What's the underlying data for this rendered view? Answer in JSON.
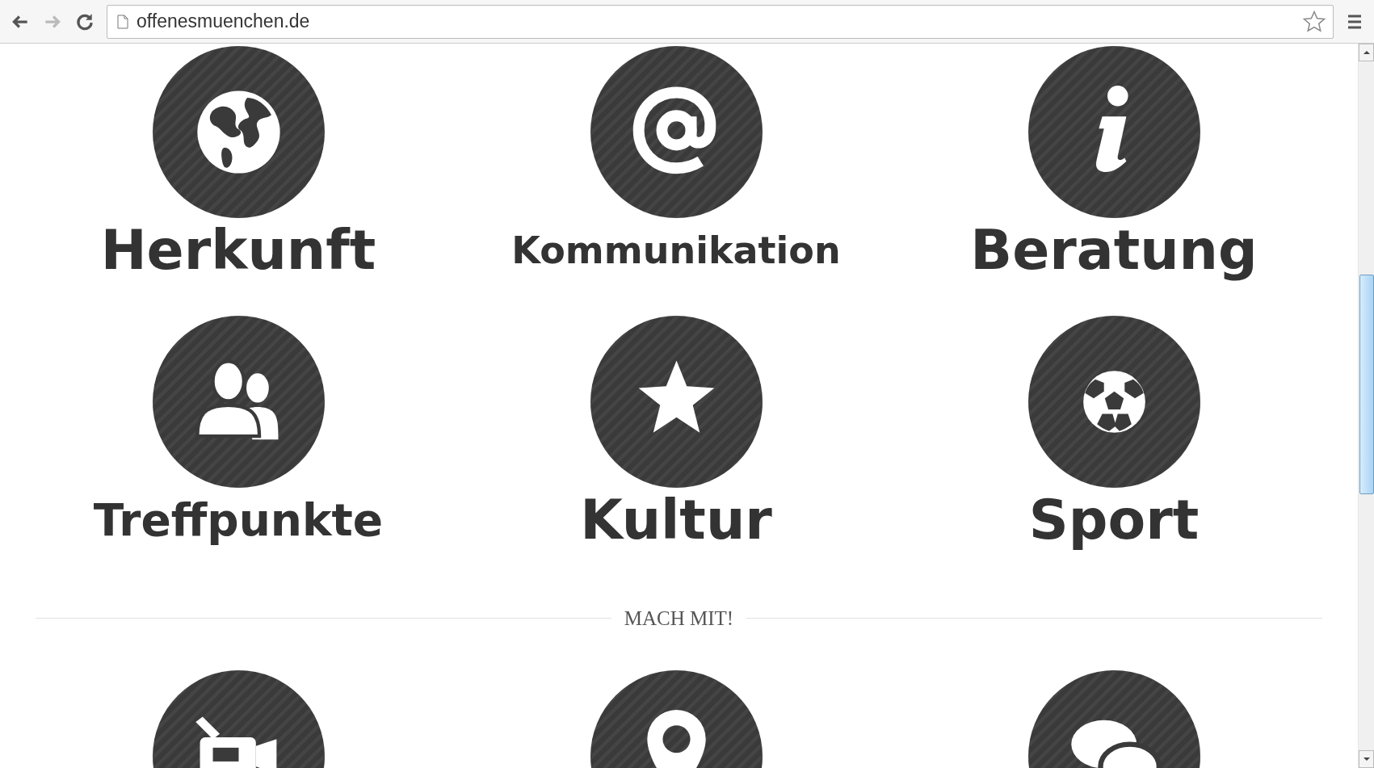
{
  "browser": {
    "url": "offenesmuenchen.de",
    "bookmarked": false
  },
  "tiles": [
    {
      "label": "Herkunft"
    },
    {
      "label": "Kommunikation"
    },
    {
      "label": "Beratung"
    },
    {
      "label": "Treffpunkte"
    },
    {
      "label": "Kultur"
    },
    {
      "label": "Sport"
    }
  ],
  "section_heading": "MACH MIT!"
}
